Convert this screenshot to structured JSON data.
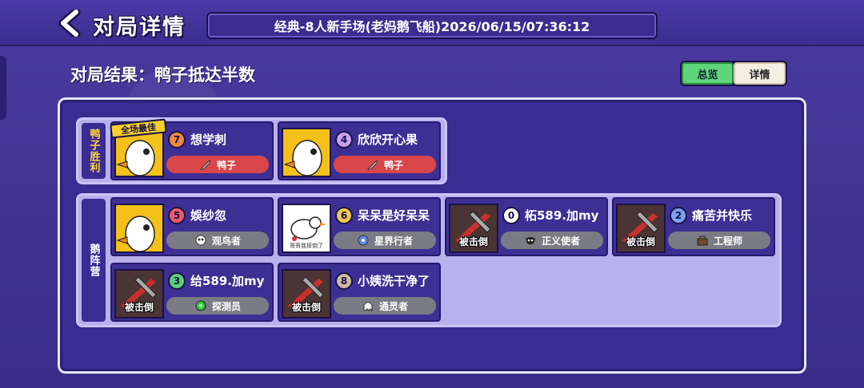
{
  "header": {
    "title": "对局详情",
    "match_info": "经典-8人新手场(老妈鹅飞船)2026/06/15/07:36:12"
  },
  "result": {
    "text": "对局结果：鸭子抵达半数"
  },
  "view_toggle": {
    "overview": "总览",
    "details": "详情",
    "active": "overview"
  },
  "groups": {
    "duck_win": {
      "label": "鸭子胜利",
      "color": "#ffd43a"
    },
    "goose_camp": {
      "label": "鹅阵营"
    }
  },
  "down_label": "被击倒",
  "best_label": "全场最佳",
  "duck_players": [
    {
      "number": "7",
      "num_color": "#f08a3a",
      "name": "想学刺",
      "role": "鸭子",
      "role_icon": "knife-icon",
      "best": true
    },
    {
      "number": "4",
      "num_color": "#c8a2f0",
      "name": "欣欣开心果",
      "role": "鸭子",
      "role_icon": "knife-icon",
      "best": false
    }
  ],
  "goose_players": [
    {
      "number": "5",
      "num_color": "#f05a6a",
      "name": "娛纱忽",
      "role": "观鸟者",
      "role_icon": "bird-watcher-icon",
      "down": false
    },
    {
      "number": "6",
      "num_color": "#f0c84a",
      "name": "呆呆是好呆呆",
      "role": "星界行者",
      "role_icon": "astral-icon",
      "down": false,
      "sign": "哥哥我摔倒了"
    },
    {
      "number": "0",
      "num_color": "#ffffff",
      "name": "柘589.加my",
      "role": "正义使者",
      "role_icon": "mask-icon",
      "down": true
    },
    {
      "number": "2",
      "num_color": "#7ea0f0",
      "name": "痛苦并快乐",
      "role": "工程师",
      "role_icon": "toolbox-icon",
      "down": true
    },
    {
      "number": "3",
      "num_color": "#5ad07a",
      "name": "给589.加my",
      "role": "探测员",
      "role_icon": "detector-icon",
      "down": true
    },
    {
      "number": "8",
      "num_color": "#c9b9a0",
      "name": "小姨洗干净了",
      "role": "通灵者",
      "role_icon": "ghost-icon",
      "down": true
    }
  ]
}
